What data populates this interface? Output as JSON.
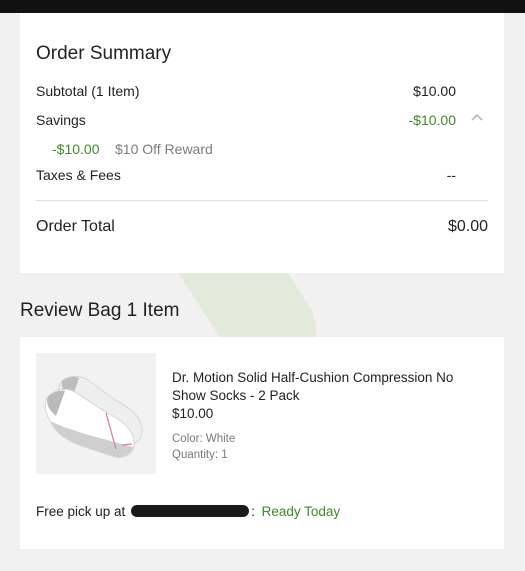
{
  "summary": {
    "title": "Order Summary",
    "subtotal_label": "Subtotal (1 Item)",
    "subtotal_value": "$10.00",
    "savings_label": "Savings",
    "savings_value": "-$10.00",
    "reward_amount": "-$10.00",
    "reward_label": "$10 Off Reward",
    "taxes_label": "Taxes & Fees",
    "taxes_value": "--",
    "total_label": "Order Total",
    "total_value": "$0.00"
  },
  "bag": {
    "title": "Review Bag 1 Item",
    "product": {
      "name": "Dr. Motion Solid Half-Cushion Compression No Show Socks - 2 Pack",
      "price": "$10.00",
      "color": "Color: White",
      "quantity": "Quantity: 1"
    },
    "pickup_prefix": "Free pick up at",
    "pickup_suffix": ":",
    "pickup_status": "Ready Today"
  },
  "icons": {
    "savings_toggle": "chevron-up-icon"
  },
  "colors": {
    "accent_green": "#3f8a2a",
    "header_bar": "#111111",
    "page_background": "#f1f1f1"
  }
}
